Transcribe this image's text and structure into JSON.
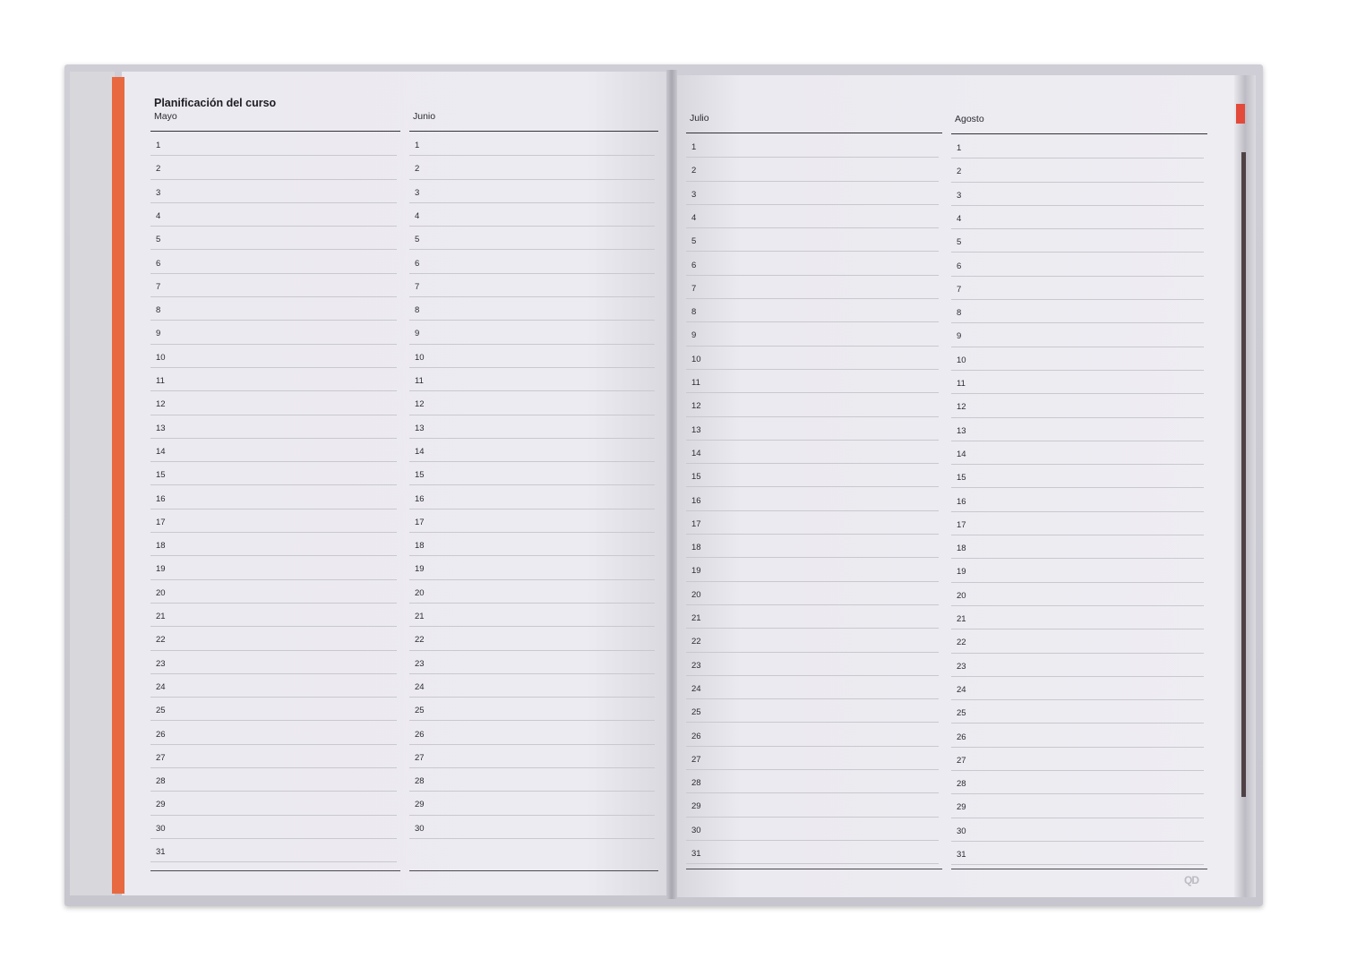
{
  "title": "Planificación del curso",
  "months": [
    {
      "name": "Mayo",
      "days": [
        "1",
        "2",
        "3",
        "4",
        "5",
        "6",
        "7",
        "8",
        "9",
        "10",
        "11",
        "12",
        "13",
        "14",
        "15",
        "16",
        "17",
        "18",
        "19",
        "20",
        "21",
        "22",
        "23",
        "24",
        "25",
        "26",
        "27",
        "28",
        "29",
        "30",
        "31"
      ]
    },
    {
      "name": "Junio",
      "days": [
        "1",
        "2",
        "3",
        "4",
        "5",
        "6",
        "7",
        "8",
        "9",
        "10",
        "11",
        "12",
        "13",
        "14",
        "15",
        "16",
        "17",
        "18",
        "19",
        "20",
        "21",
        "22",
        "23",
        "24",
        "25",
        "26",
        "27",
        "28",
        "29",
        "30"
      ]
    },
    {
      "name": "Julio",
      "days": [
        "1",
        "2",
        "3",
        "4",
        "5",
        "6",
        "7",
        "8",
        "9",
        "10",
        "11",
        "12",
        "13",
        "14",
        "15",
        "16",
        "17",
        "18",
        "19",
        "20",
        "21",
        "22",
        "23",
        "24",
        "25",
        "26",
        "27",
        "28",
        "29",
        "30",
        "31"
      ]
    },
    {
      "name": "Agosto",
      "days": [
        "1",
        "2",
        "3",
        "4",
        "5",
        "6",
        "7",
        "8",
        "9",
        "10",
        "11",
        "12",
        "13",
        "14",
        "15",
        "16",
        "17",
        "18",
        "19",
        "20",
        "21",
        "22",
        "23",
        "24",
        "25",
        "26",
        "27",
        "28",
        "29",
        "30",
        "31"
      ]
    }
  ],
  "brand_logo": "QD",
  "colors": {
    "accent": "#e8693f",
    "paper": "#ecebf1",
    "cover": "#cfced6"
  }
}
